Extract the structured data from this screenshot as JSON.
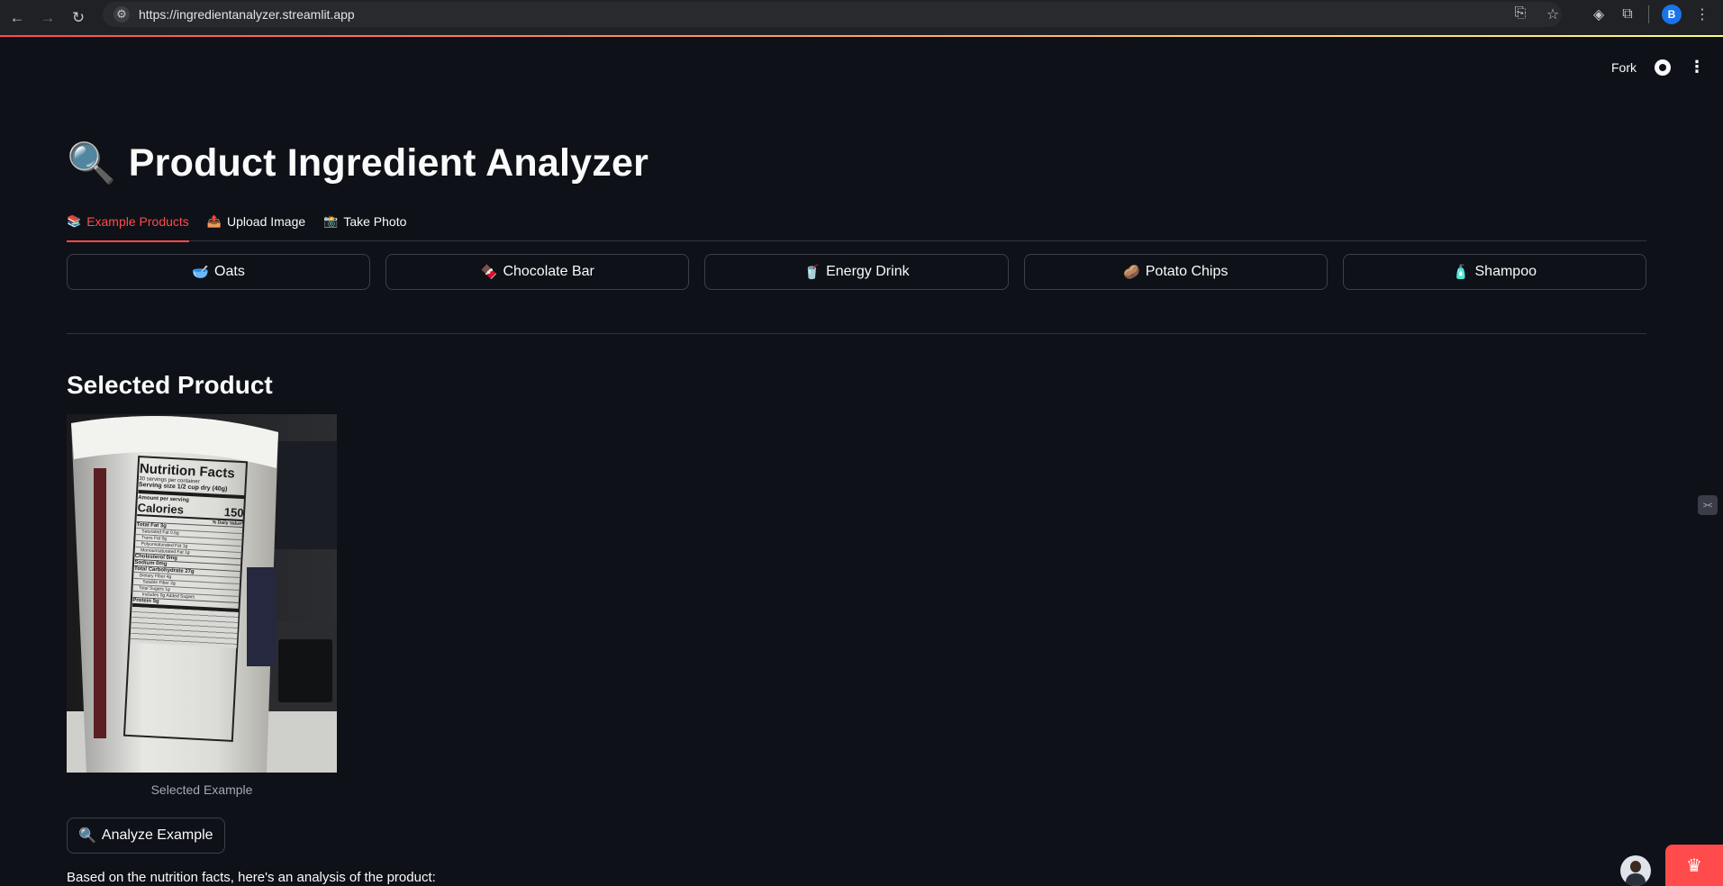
{
  "browser": {
    "url": "https://ingredientanalyzer.streamlit.app",
    "profile_initial": "B"
  },
  "header": {
    "fork_label": "Fork"
  },
  "page": {
    "title_icon": "🔍",
    "title": "Product Ingredient Analyzer"
  },
  "tabs": [
    {
      "icon": "📚",
      "label": "Example Products",
      "active": true
    },
    {
      "icon": "📤",
      "label": "Upload Image",
      "active": false
    },
    {
      "icon": "📸",
      "label": "Take Photo",
      "active": false
    }
  ],
  "products": [
    {
      "icon": "🥣",
      "label": "Oats"
    },
    {
      "icon": "🍫",
      "label": "Chocolate Bar"
    },
    {
      "icon": "🥤",
      "label": "Energy Drink"
    },
    {
      "icon": "🥔",
      "label": "Potato Chips"
    },
    {
      "icon": "🧴",
      "label": "Shampoo"
    }
  ],
  "selected": {
    "heading": "Selected Product",
    "caption": "Selected Example",
    "label_panel": {
      "title": "Nutrition Facts",
      "servings": "30 servings per container",
      "serving_size": "Serving size  1/2 cup dry (40g)",
      "amount": "Amount per serving",
      "calories_label": "Calories",
      "calories_value": "150",
      "dv": "% Daily Value*",
      "rows": [
        "Total Fat 3g",
        "Saturated Fat 0.5g",
        "Trans Fat 0g",
        "Polyunsaturated Fat 1g",
        "Monounsaturated Fat 1g",
        "Cholesterol 0mg",
        "Sodium 0mg",
        "Total Carbohydrate 27g",
        "Dietary Fiber 4g",
        "Soluble Fiber 2g",
        "Total Sugars 1g",
        "Includes 0g Added Sugars",
        "Protein 5g"
      ]
    }
  },
  "analyze_button": {
    "icon": "🔍",
    "label": "Analyze Example"
  },
  "result_intro": "Based on the nutrition facts, here's an analysis of the product:",
  "colors": {
    "accent": "#ff4b4b",
    "background": "#0e1117",
    "border": "#3d404a"
  }
}
